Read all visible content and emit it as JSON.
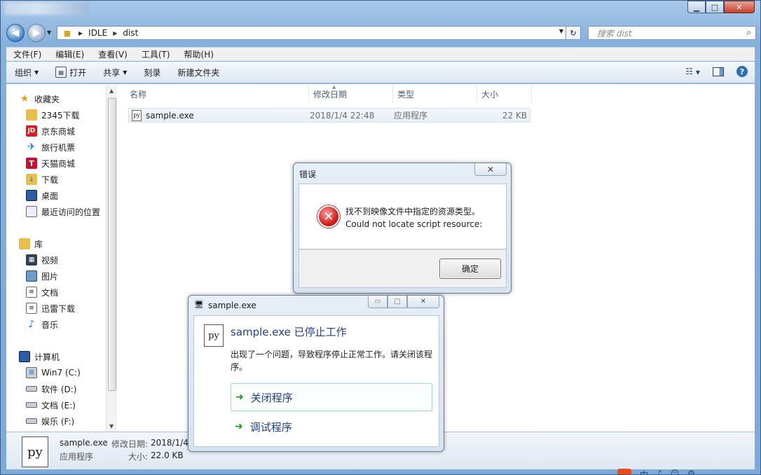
{
  "window": {
    "controls": {
      "minimize": "▁",
      "maximize": "□",
      "close": "✕"
    }
  },
  "address": {
    "path": [
      "IDLE",
      "dist"
    ],
    "search_placeholder": "搜索 dist"
  },
  "menu": [
    "文件(F)",
    "编辑(E)",
    "查看(V)",
    "工具(T)",
    "帮助(H)"
  ],
  "toolbar": {
    "organize": "组织",
    "open": "打开",
    "share": "共享",
    "burn": "刻录",
    "new_folder": "新建文件夹"
  },
  "sidebar": {
    "favorites_label": "收藏夹",
    "favorites": [
      {
        "label": "2345下载",
        "icon": "folder-icon"
      },
      {
        "label": "京东商城",
        "icon": "jd-icon"
      },
      {
        "label": "旅行机票",
        "icon": "travel-icon"
      },
      {
        "label": "天猫商城",
        "icon": "tmall-icon"
      },
      {
        "label": "下载",
        "icon": "download-folder-icon"
      },
      {
        "label": "桌面",
        "icon": "desktop-icon"
      },
      {
        "label": "最近访问的位置",
        "icon": "recent-places-icon"
      }
    ],
    "library_label": "库",
    "library": [
      {
        "label": "视频",
        "icon": "video-icon"
      },
      {
        "label": "图片",
        "icon": "picture-icon"
      },
      {
        "label": "文档",
        "icon": "document-icon"
      },
      {
        "label": "迅雷下载",
        "icon": "thunder-download-icon"
      },
      {
        "label": "音乐",
        "icon": "music-icon"
      }
    ],
    "computer_label": "计算机",
    "computer": [
      {
        "label": "Win7 (C:)",
        "icon": "system-drive-icon"
      },
      {
        "label": "软件 (D:)",
        "icon": "drive-icon"
      },
      {
        "label": "文档 (E:)",
        "icon": "drive-icon"
      },
      {
        "label": "娱乐 (F:)",
        "icon": "drive-icon"
      }
    ]
  },
  "columns": {
    "name": "名称",
    "date": "修改日期",
    "type": "类型",
    "size": "大小"
  },
  "files": [
    {
      "name": "sample.exe",
      "date": "2018/1/4 22:48",
      "type": "应用程序",
      "size": "22 KB"
    }
  ],
  "details": {
    "name": "sample.exe",
    "modified_label": "修改日期:",
    "modified": "2018/1/4",
    "type": "应用程序",
    "size_label": "大小:",
    "size": "22.0 KB",
    "icon_text": "py"
  },
  "error_dialog": {
    "title": "错误",
    "line1": "找不到映像文件中指定的资源类型。",
    "line2": "Could not locate script resource:",
    "ok": "确定"
  },
  "stop_dialog": {
    "title": "sample.exe",
    "heading": "sample.exe 已停止工作",
    "description": "出现了一个问题，导致程序停止正常工作。请关闭该程序。",
    "option_close": "关闭程序",
    "option_debug": "调试程序",
    "icon_text": "py"
  },
  "tray": [
    "中",
    "♪",
    "☺",
    "⚙"
  ]
}
